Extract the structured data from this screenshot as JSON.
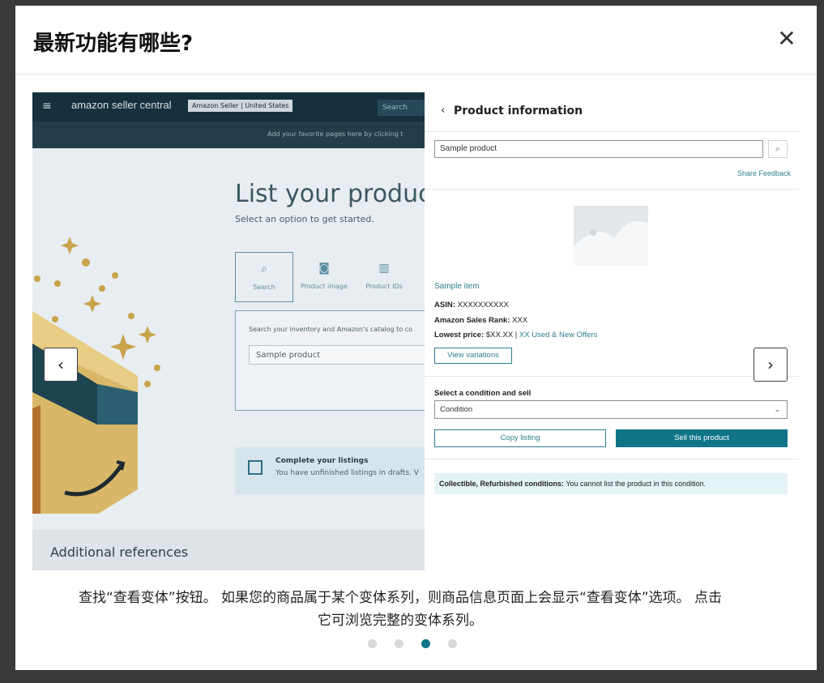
{
  "modal": {
    "title": "最新功能有哪些?",
    "close_label": "✕"
  },
  "slide": {
    "seller_central": {
      "menu_icon": "≡",
      "logo": "amazon seller central",
      "account_badge": "Amazon Seller | United States",
      "search_label": "Search",
      "favorites_text": "Add your favorite pages here by clicking t",
      "heading": "List your product",
      "subheading": "Select an option to get started.",
      "tabs": [
        {
          "label": "Search",
          "icon": "search-icon"
        },
        {
          "label": "Product image",
          "icon": "camera-icon"
        },
        {
          "label": "Product IDs",
          "icon": "barcode-icon"
        }
      ],
      "search_box_label": "Search your inventory and Amazon's catalog to co",
      "search_box_value": "Sample product",
      "complete_title": "Complete your listings",
      "complete_desc": "You have unfinished listings in drafts. V",
      "additional_refs": "Additional references"
    },
    "panel": {
      "back_icon": "‹",
      "title": "Product information",
      "search_value": "Sample product",
      "share_feedback": "Share Feedback",
      "item_name": "Sample item",
      "asin_label": "ASIN:",
      "asin_value": "XXXXXXXXXX",
      "rank_label": "Amazon Sales Rank:",
      "rank_value": "XXX",
      "price_label": "Lowest price:",
      "price_value": "$XX.XX |",
      "offers_link": "XX Used & New Offers",
      "view_variations": "View variations",
      "condition_label": "Select a condition and sell",
      "condition_value": "Condition",
      "copy_listing": "Copy listing",
      "sell_product": "Sell this product",
      "notice_bold": "Collectible, Refurbished conditions:",
      "notice_text": "You cannot list the product in this condition."
    }
  },
  "nav": {
    "prev_icon": "‹",
    "next_icon": "›"
  },
  "caption": {
    "line1": "查找“查看变体”按钮。 如果您的商品属于某个变体系列，则商品信息页面上会显示“查看变体”选项。 点击",
    "line2": "它可浏览完整的变体系列。"
  },
  "pagination": {
    "total": 4,
    "active_index": 2
  },
  "colors": {
    "accent": "#0f7488",
    "link": "#2f7e90",
    "notice_bg": "#e4f3f6"
  }
}
